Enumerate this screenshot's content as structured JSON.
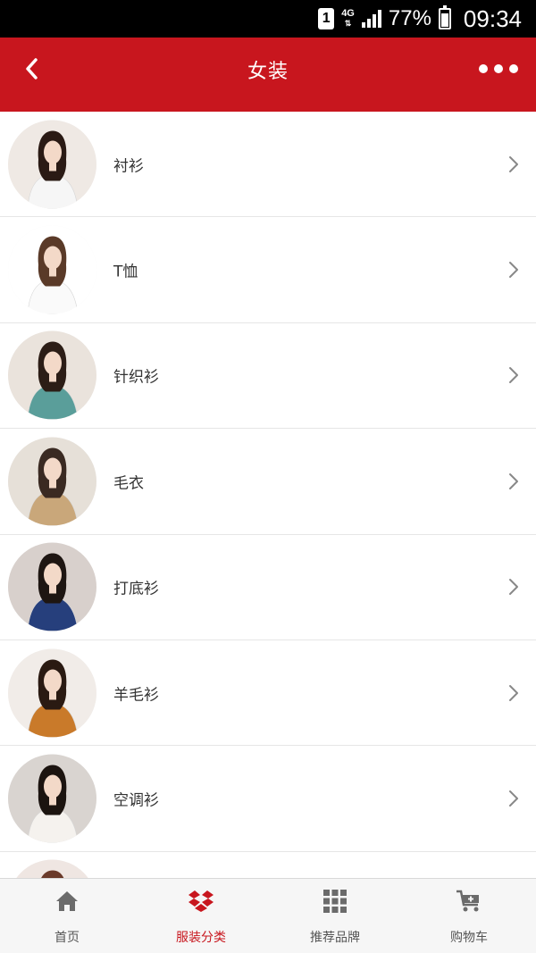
{
  "status_bar": {
    "sim": "1",
    "network": "4G",
    "network_arrows": "⇅",
    "battery_percent": "77%",
    "battery_level": 0.77,
    "time": "09:34"
  },
  "header": {
    "title": "女装",
    "back_icon": "chevron-left-icon",
    "more_icon": "more-dots-icon",
    "color": "#c8161e"
  },
  "categories": [
    {
      "label": "衬衫",
      "thumb_colors": [
        "#efe9e4",
        "#f6f6f6",
        "#2a1a14"
      ]
    },
    {
      "label": "T恤",
      "thumb_colors": [
        "#ffffff",
        "#fafafa",
        "#5a3a28"
      ]
    },
    {
      "label": "针织衫",
      "thumb_colors": [
        "#eae3dc",
        "#5a9e9a",
        "#2c1d16"
      ]
    },
    {
      "label": "毛衣",
      "thumb_colors": [
        "#e6e0d8",
        "#c9a77a",
        "#3a2a22"
      ]
    },
    {
      "label": "打底衫",
      "thumb_colors": [
        "#d8d0cc",
        "#263f7c",
        "#1e1612"
      ]
    },
    {
      "label": "羊毛衫",
      "thumb_colors": [
        "#f1ece8",
        "#c97a2a",
        "#2a1a12"
      ]
    },
    {
      "label": "空调衫",
      "thumb_colors": [
        "#d9d4d0",
        "#f5f2ee",
        "#1c1410"
      ]
    },
    {
      "label": "",
      "thumb_colors": [
        "#efe6e2",
        "#d8b8a8",
        "#6a3a2a"
      ]
    }
  ],
  "tabbar": {
    "active_color": "#c8161e",
    "tabs": [
      {
        "label": "首页",
        "icon": "home-icon"
      },
      {
        "label": "服装分类",
        "icon": "dropbox-box-icon",
        "active": true
      },
      {
        "label": "推荐品牌",
        "icon": "grid-icon"
      },
      {
        "label": "购物车",
        "icon": "cart-icon"
      }
    ]
  }
}
